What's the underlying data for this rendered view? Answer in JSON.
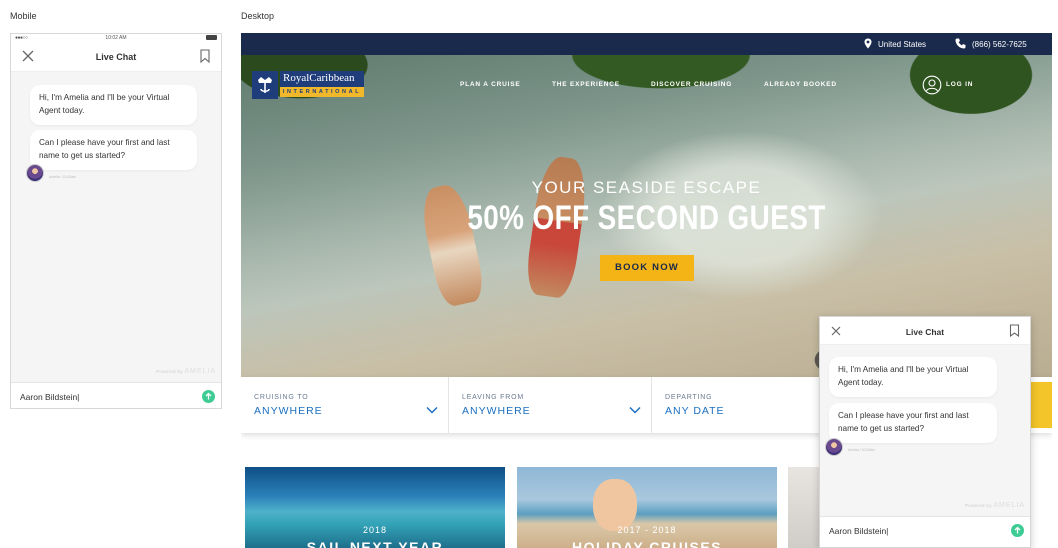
{
  "labels": {
    "mobile": "Mobile",
    "desktop": "Desktop"
  },
  "mobile": {
    "status": {
      "time": "10:02 AM",
      "signal": "●●●○○"
    },
    "chat": {
      "title": "Live Chat",
      "messages": [
        "Hi, I'm Amelia and I'll be your Virtual Agent today.",
        "Can I please have your first and last name to get us started?"
      ],
      "meta": "Amelia / 10:02am",
      "powered_prefix": "Powered by",
      "powered_brand": "AMELIA",
      "input_value": "Aaron Bildstein|"
    }
  },
  "desktop": {
    "topbar": {
      "country": "United States",
      "phone": "(866) 562-7625"
    },
    "logo": {
      "name": "RoyalCaribbean",
      "sub": "INTERNATIONAL"
    },
    "nav": [
      "PLAN A CRUISE",
      "THE EXPERIENCE",
      "DISCOVER CRUISING",
      "ALREADY BOOKED"
    ],
    "login": "LOG IN",
    "hero": {
      "subtitle": "YOUR SEASIDE ESCAPE",
      "headline": "50% OFF SECOND GUEST",
      "cta": "BOOK NOW"
    },
    "search": [
      {
        "label": "CRUISING TO",
        "value": "ANYWHERE"
      },
      {
        "label": "LEAVING FROM",
        "value": "ANYWHERE"
      },
      {
        "label": "DEPARTING",
        "value": "ANY DATE"
      }
    ],
    "cards": [
      {
        "year": "2018",
        "title": "SAIL NEXT YEAR"
      },
      {
        "year": "2017 - 2018",
        "title": "HOLIDAY CRUISES"
      }
    ],
    "chat": {
      "title": "Live Chat",
      "messages": [
        "Hi, I'm Amelia and I'll be your Virtual Agent today.",
        "Can I please have your first and last name to get us started?"
      ],
      "meta": "Amelia / 10:02am",
      "powered_prefix": "Powered by",
      "powered_brand": "AMELIA",
      "input_value": "Aaron Bildstein|"
    }
  },
  "colors": {
    "navy": "#1a2a4c",
    "gold": "#f4b416",
    "link_blue": "#1a6fc1",
    "send_green": "#3ecb94"
  },
  "icons": [
    "close-icon",
    "bookmark-icon",
    "send-icon",
    "location-pin-icon",
    "phone-icon",
    "user-circle-icon",
    "chevron-down-icon"
  ]
}
